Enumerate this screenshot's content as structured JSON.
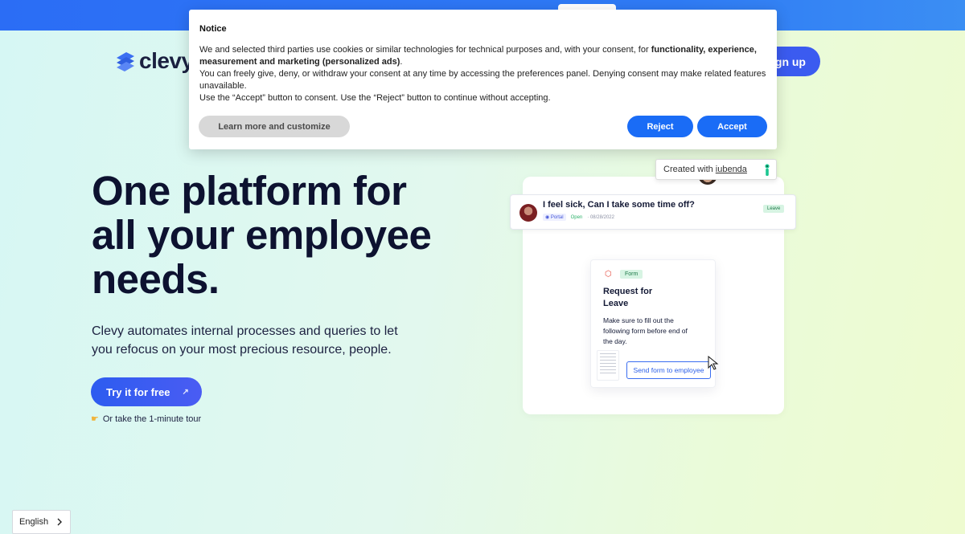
{
  "header": {
    "logo_text": "clevy",
    "signup_label": "ign up"
  },
  "hero": {
    "title_lines": [
      "One platform for",
      "all your employee",
      "needs."
    ],
    "subtitle_lines": [
      "Clevy automates internal processes and queries to let",
      "you refocus on your most precious resource, people."
    ],
    "cta_label": "Try it for free",
    "tour_label": "Or take the 1-minute tour"
  },
  "ticket": {
    "title": "I feel sick, Can I take some time off?",
    "portal": "Portal",
    "status": "Open",
    "date": "08/28/2022",
    "badge": "Leave"
  },
  "form_card": {
    "tag": "Form",
    "title_lines": [
      "Request for",
      "Leave"
    ],
    "description_lines": [
      "Make sure to fill out the",
      "following form before end of",
      "the day."
    ],
    "send_label": "Send form to employee"
  },
  "cookie_notice": {
    "title": "Notice",
    "line1_prefix": "We and selected third parties use cookies or similar technologies for technical purposes and, with your consent, for ",
    "line1_bold_a": "functionality, experience,",
    "line1_bold_b": "measurement and marketing (personalized ads)",
    "line1_suffix": ".",
    "line2": "You can freely give, deny, or withdraw your consent at any time by accessing the preferences panel. Denying consent may make related features unavailable.",
    "line3": "Use the “Accept” button to consent. Use the “Reject” button to continue without accepting.",
    "learn_more_label": "Learn more and customize",
    "reject_label": "Reject",
    "accept_label": "Accept"
  },
  "iubenda": {
    "prefix": "Created with",
    "link": "iubenda"
  },
  "language": {
    "selected": "English"
  },
  "colors": {
    "brand_blue": "#1a6cf6",
    "cta_blue": "#2d5cf0",
    "tag_green": "#d7f4e3"
  }
}
